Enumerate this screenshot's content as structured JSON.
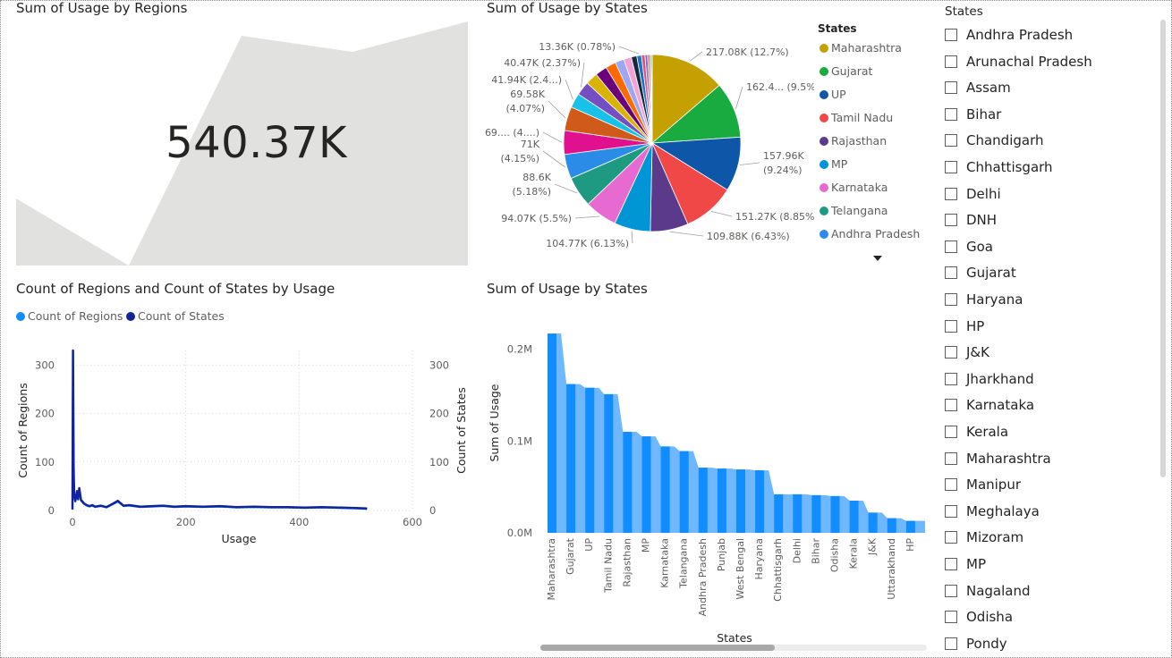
{
  "visuals": {
    "card_title": "Sum of Usage by Regions",
    "card_value": "540.37K",
    "pie_title": "Sum of Usage by States",
    "combo_title": "Count of Regions and Count of States by Usage",
    "bar_title": "Sum of Usage by States"
  },
  "colors": {
    "count_regions": "#118dff",
    "count_states": "#12239e",
    "bar_fill": "#118dff",
    "card_bg_shape": "#e1e1df"
  },
  "combo_legend": [
    {
      "label": "Count of Regions",
      "color": "#118dff"
    },
    {
      "label": "Count of States",
      "color": "#12239e"
    }
  ],
  "pie_legend": {
    "title": "States",
    "items": [
      {
        "label": "Maharashtra",
        "color": "#c4a000"
      },
      {
        "label": "Gujarat",
        "color": "#1aab40"
      },
      {
        "label": "UP",
        "color": "#12239e"
      },
      {
        "label": "Tamil Nadu",
        "color": "#e66c37"
      },
      {
        "label": "Rajasthan",
        "color": "#6b007b"
      },
      {
        "label": "MP",
        "color": "#118dff"
      },
      {
        "label": "Karnataka",
        "color": "#e044a7"
      },
      {
        "label": "Telangana",
        "color": "#15c6f4"
      },
      {
        "label": "Andhra Pradesh",
        "color": "#4a8ddc"
      }
    ],
    "more_icon": "caret-down-icon"
  },
  "slicer": {
    "title": "States",
    "items": [
      "Andhra Pradesh",
      "Arunachal Pradesh",
      "Assam",
      "Bihar",
      "Chandigarh",
      "Chhattisgarh",
      "Delhi",
      "DNH",
      "Goa",
      "Gujarat",
      "Haryana",
      "HP",
      "J&K",
      "Jharkhand",
      "Karnataka",
      "Kerala",
      "Maharashtra",
      "Manipur",
      "Meghalaya",
      "Mizoram",
      "MP",
      "Nagaland",
      "Odisha",
      "Pondy"
    ]
  },
  "chart_data": [
    {
      "type": "pie",
      "title": "Sum of Usage by States",
      "legend_title": "States",
      "legend_position": "right",
      "slices": [
        {
          "label": "Maharashtra",
          "value": 217.08,
          "data_label": "217.08K (12.7%)",
          "color": "#c4a000"
        },
        {
          "label": "Gujarat",
          "value": 162.4,
          "data_label": "162.4... (9.5%)",
          "color": "#1aab40"
        },
        {
          "label": "UP",
          "value": 157.96,
          "data_label": "157.96K (9.24%)",
          "color": "#0d56a8"
        },
        {
          "label": "Tamil Nadu",
          "value": 151.27,
          "data_label": "151.27K (8.85%)",
          "color": "#f04747"
        },
        {
          "label": "Rajasthan",
          "value": 109.88,
          "data_label": "109.88K (6.43%)",
          "color": "#5b3a8c"
        },
        {
          "label": "MP",
          "value": 104.77,
          "data_label": "104.77K (6.13%)",
          "color": "#0096d6"
        },
        {
          "label": "Karnataka",
          "value": 94.07,
          "data_label": "94.07K (5.5%)",
          "color": "#e66ad2"
        },
        {
          "label": "Telangana",
          "value": 88.6,
          "data_label": "88.6K (5.18%)",
          "color": "#1f9a82"
        },
        {
          "label": "Andhra Pradesh",
          "value": 71.0,
          "data_label": "71K (4.15%)",
          "color": "#2b8ce8"
        },
        {
          "label": "",
          "value": 69.0,
          "data_label": "69.... (4....)",
          "color": "#e0108f"
        },
        {
          "label": "",
          "value": 69.58,
          "data_label": "69.58K (4.07%)",
          "color": "#cf5a1a"
        },
        {
          "label": "",
          "value": 41.94,
          "data_label": "41.94K (2.4...)",
          "color": "#17c1e8"
        },
        {
          "label": "",
          "value": 40.47,
          "data_label": "40.47K (2.37%)",
          "color": "#744ec2"
        },
        {
          "label": "",
          "value": 36,
          "data_label": "",
          "color": "#d9b300"
        },
        {
          "label": "",
          "value": 34,
          "data_label": "",
          "color": "#6b007b"
        },
        {
          "label": "",
          "value": 30,
          "data_label": "",
          "color": "#ff6a00"
        },
        {
          "label": "",
          "value": 26,
          "data_label": "",
          "color": "#9ea7f5"
        },
        {
          "label": "",
          "value": 22,
          "data_label": "",
          "color": "#f2a3d6"
        },
        {
          "label": "",
          "value": 16,
          "data_label": "",
          "color": "#15293d"
        },
        {
          "label": "",
          "value": 13.36,
          "data_label": "13.36K (0.78%)",
          "color": "#1a73c8"
        },
        {
          "label": "",
          "value": 10,
          "data_label": "",
          "color": "#e04f7e"
        },
        {
          "label": "",
          "value": 8,
          "data_label": "",
          "color": "#8a6bbf"
        },
        {
          "label": "",
          "value": 6,
          "data_label": "",
          "color": "#d46a6a"
        },
        {
          "label": "",
          "value": 4,
          "data_label": "",
          "color": "#3a9a5a"
        },
        {
          "label": "",
          "value": 3,
          "data_label": "",
          "color": "#999999"
        }
      ]
    },
    {
      "type": "line",
      "title": "Count of Regions and Count of States by Usage",
      "xlabel": "Usage",
      "ylabel_left": "Count of Regions",
      "ylabel_right": "Count of States",
      "xlim": [
        0,
        600
      ],
      "ylim": [
        0,
        330
      ],
      "x_ticks": [
        "0",
        "200",
        "400",
        "600"
      ],
      "y_ticks": [
        "0",
        "100",
        "200",
        "300"
      ],
      "grid": true,
      "series": [
        {
          "name": "Count of Regions",
          "color": "#118dff",
          "points": [
            [
              0,
              2
            ],
            [
              1,
              320
            ],
            [
              2,
              85
            ],
            [
              3,
              30
            ],
            [
              5,
              18
            ],
            [
              8,
              38
            ],
            [
              10,
              22
            ],
            [
              12,
              44
            ],
            [
              15,
              20
            ],
            [
              20,
              14
            ],
            [
              25,
              10
            ],
            [
              30,
              8
            ],
            [
              35,
              10
            ],
            [
              40,
              7
            ],
            [
              50,
              9
            ],
            [
              60,
              6
            ],
            [
              70,
              12
            ],
            [
              80,
              18
            ],
            [
              90,
              9
            ],
            [
              100,
              10
            ],
            [
              120,
              7
            ],
            [
              140,
              8
            ],
            [
              160,
              9
            ],
            [
              180,
              7
            ],
            [
              200,
              8
            ],
            [
              230,
              7
            ],
            [
              260,
              8
            ],
            [
              290,
              6
            ],
            [
              320,
              7
            ],
            [
              350,
              6
            ],
            [
              380,
              6
            ],
            [
              410,
              5
            ],
            [
              440,
              6
            ],
            [
              470,
              5
            ],
            [
              500,
              4
            ],
            [
              520,
              3
            ]
          ]
        },
        {
          "name": "Count of States",
          "color": "#12239e",
          "points": [
            [
              0,
              2
            ],
            [
              1,
              330
            ],
            [
              2,
              90
            ],
            [
              3,
              32
            ],
            [
              5,
              20
            ],
            [
              8,
              40
            ],
            [
              10,
              24
            ],
            [
              12,
              46
            ],
            [
              15,
              22
            ],
            [
              20,
              15
            ],
            [
              25,
              11
            ],
            [
              30,
              9
            ],
            [
              35,
              11
            ],
            [
              40,
              8
            ],
            [
              50,
              10
            ],
            [
              60,
              7
            ],
            [
              70,
              13
            ],
            [
              80,
              20
            ],
            [
              90,
              10
            ],
            [
              100,
              11
            ],
            [
              120,
              8
            ],
            [
              140,
              9
            ],
            [
              160,
              10
            ],
            [
              180,
              8
            ],
            [
              200,
              9
            ],
            [
              230,
              8
            ],
            [
              260,
              9
            ],
            [
              290,
              7
            ],
            [
              320,
              8
            ],
            [
              350,
              7
            ],
            [
              380,
              7
            ],
            [
              410,
              6
            ],
            [
              440,
              7
            ],
            [
              470,
              6
            ],
            [
              500,
              5
            ],
            [
              520,
              4
            ]
          ]
        }
      ]
    },
    {
      "type": "area",
      "title": "Sum of Usage by States",
      "xlabel": "States",
      "ylabel": "Sum of Usage",
      "y_ticks": [
        "0.0M",
        "0.1M",
        "0.2M"
      ],
      "ylim": [
        0,
        0.22
      ],
      "categories": [
        "Maharashtra",
        "Gujarat",
        "UP",
        "Tamil Nadu",
        "Rajasthan",
        "MP",
        "Karnataka",
        "Telangana",
        "Andhra Pradesh",
        "Punjab",
        "West Bengal",
        "Haryana",
        "Chhattisgarh",
        "Delhi",
        "Bihar",
        "Odisha",
        "Kerala",
        "J&K",
        "Uttarakhand",
        "HP"
      ],
      "values": [
        0.217,
        0.162,
        0.158,
        0.151,
        0.11,
        0.105,
        0.094,
        0.089,
        0.071,
        0.07,
        0.069,
        0.068,
        0.042,
        0.042,
        0.041,
        0.04,
        0.035,
        0.022,
        0.016,
        0.013
      ]
    }
  ]
}
